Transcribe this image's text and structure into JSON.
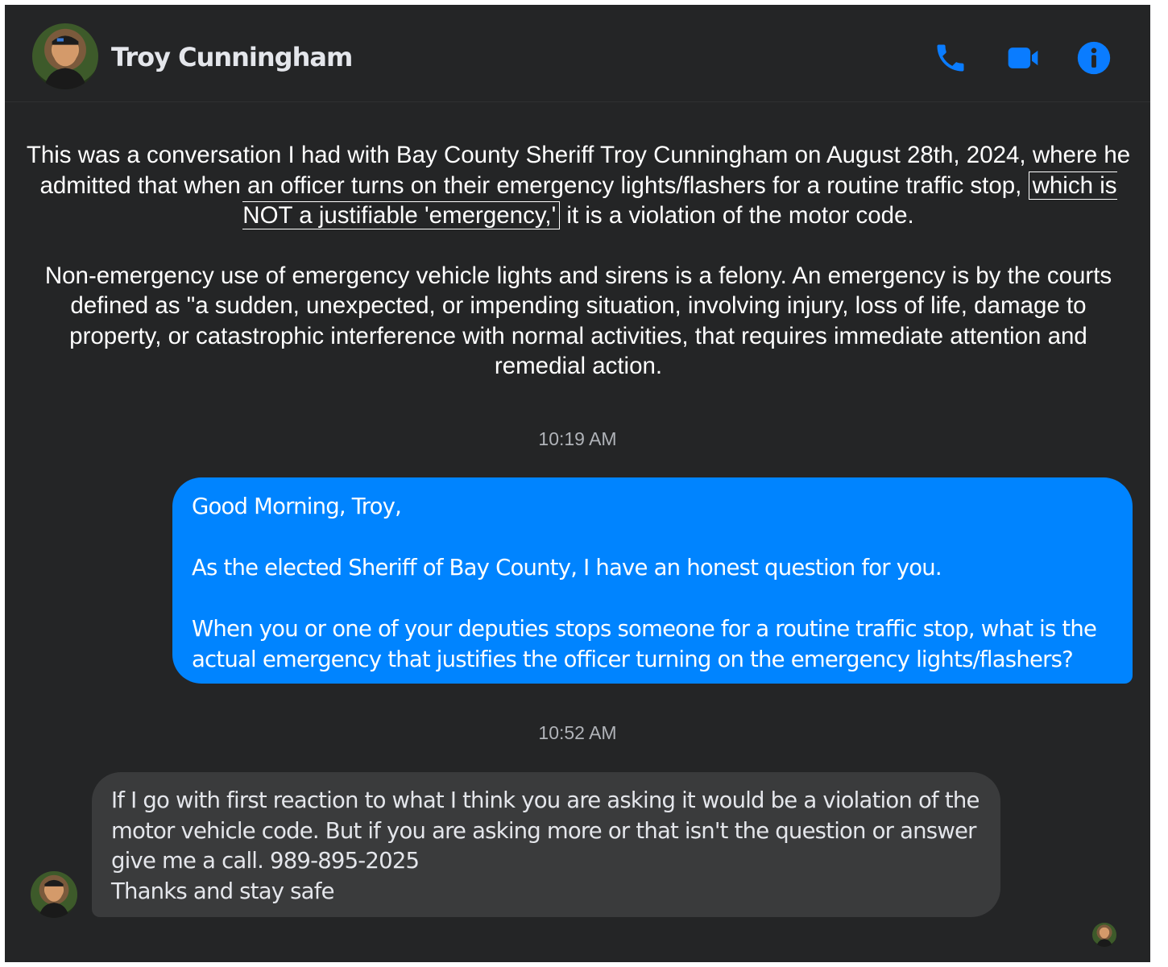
{
  "header": {
    "contact_name": "Troy Cunningham",
    "icons": [
      "phone-icon",
      "video-camera-icon",
      "info-icon"
    ],
    "accent_color": "#0084ff"
  },
  "caption": {
    "p1_before": "This was a conversation I had with Bay County Sheriff Troy Cunningham on August 28th, 2024, where he admitted that when an officer turns on their emergency lights/flashers for a routine traffic stop,",
    "p1_boxed": "which is NOT a justifiable 'emergency,'",
    "p1_after": "it is a violation of the motor code.",
    "p2": "Non-emergency use of emergency vehicle lights and sirens is a felony. An emergency is by the courts defined as \"a sudden, unexpected, or impending situation, involving injury, loss of life, damage to property, or catastrophic interference with normal activities, that requires immediate attention and remedial action."
  },
  "messages": {
    "timestamp_1": "10:19 AM",
    "outgoing": {
      "greeting": "Good Morning, Troy,",
      "line_2": "As the elected Sheriff of Bay County, I have an honest question for you.",
      "line_3a": "When you or one of your deputies stops someone for a routine traffic stop, what is the",
      "line_3b": "actual emergency that justifies the officer turning on the emergency lights/flashers?"
    },
    "timestamp_2": "10:52 AM",
    "incoming": {
      "line_1": "If I go with first reaction to what I think you are asking it would be a violation of the",
      "line_2": "motor vehicle code. But if you are asking more or that isn't the question or answer",
      "line_3": "give me a call. 989-895-2025",
      "line_4": "Thanks and stay safe"
    }
  }
}
